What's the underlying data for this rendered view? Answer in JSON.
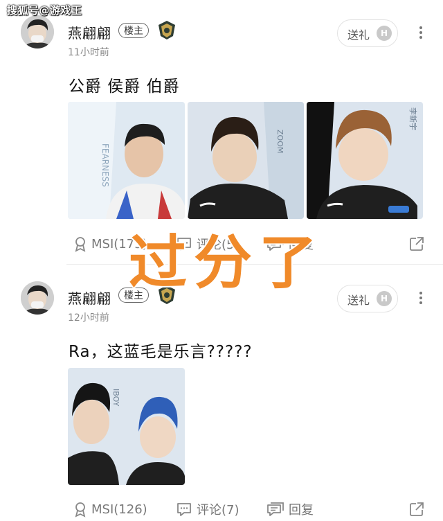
{
  "watermark": "搜狐号@游戏王",
  "overlay_text": "过分了",
  "posts": [
    {
      "username": "燕翩翩",
      "host_badge": "楼主",
      "time": "11小时前",
      "gift_label": "送礼",
      "gift_icon_letter": "H",
      "content": "公爵 侯爵 伯爵",
      "actions": {
        "msi": "MSI(173)",
        "comment": "评论(5)",
        "reply": "回复"
      },
      "photos": [
        {
          "side_text": "FEARNESS"
        },
        {
          "side_text": "ZOOM"
        },
        {
          "side_text": "李新宇"
        }
      ]
    },
    {
      "username": "燕翩翩",
      "host_badge": "楼主",
      "time": "12小时前",
      "gift_label": "送礼",
      "gift_icon_letter": "H",
      "content": "Ra，这蓝毛是乐言?????",
      "actions": {
        "msi": "MSI(126)",
        "comment": "评论(7)",
        "reply": "回复"
      },
      "photos": [
        {
          "side_text": "IBOY"
        }
      ]
    }
  ]
}
